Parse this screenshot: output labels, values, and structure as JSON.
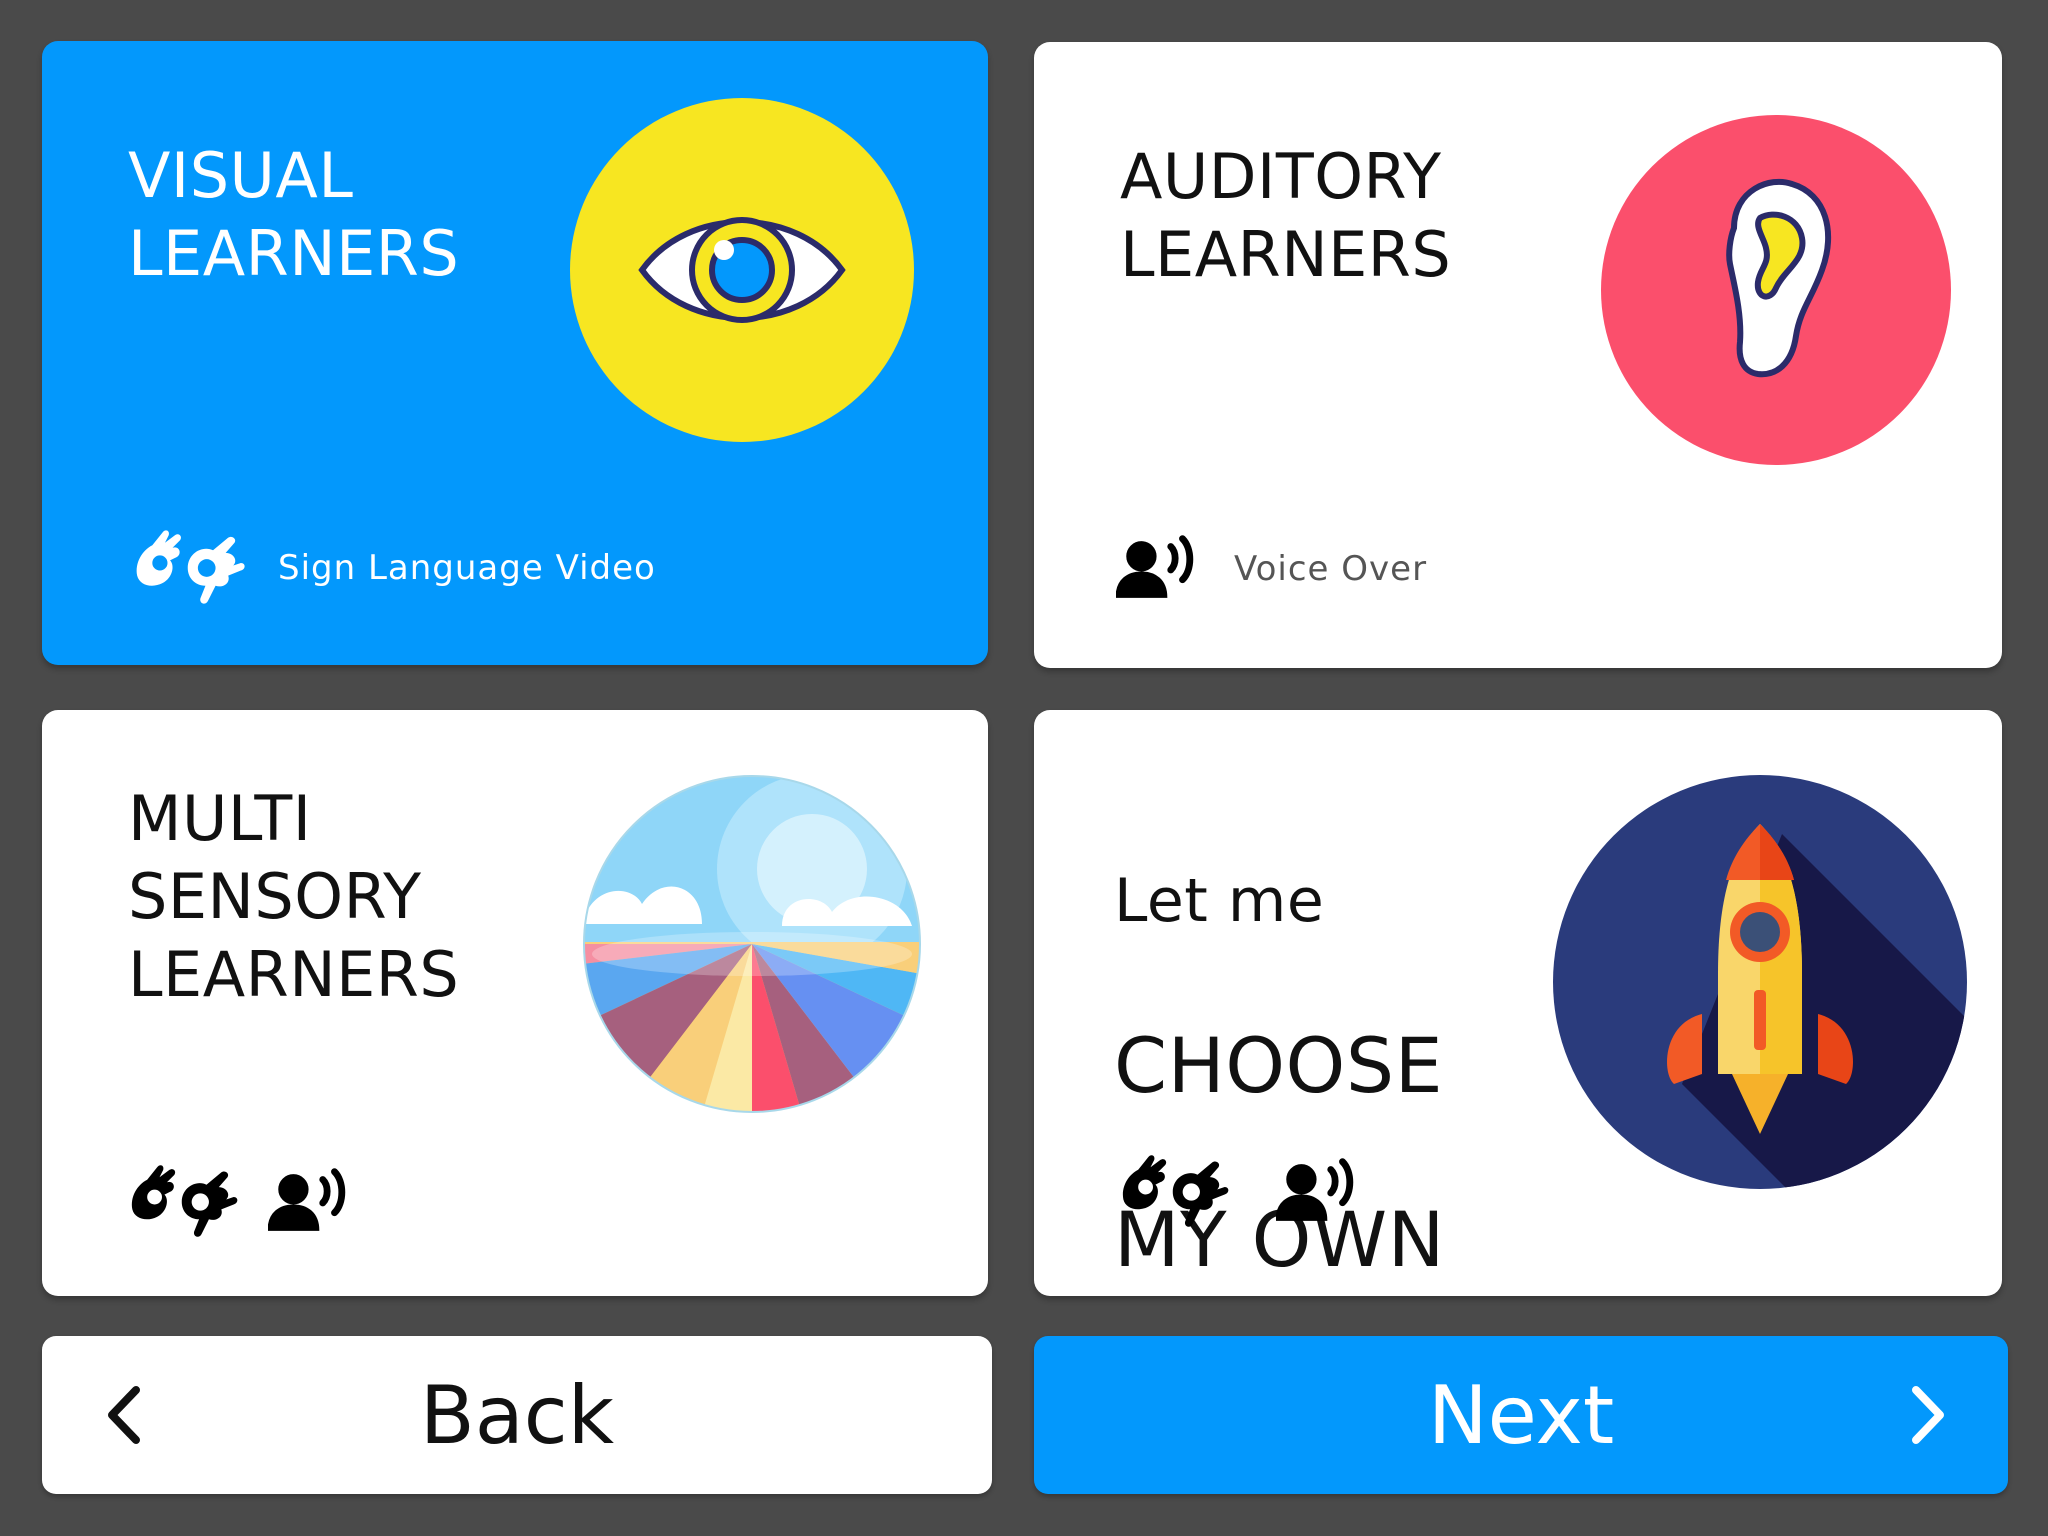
{
  "cards": {
    "visual": {
      "title": "VISUAL\nLEARNERS",
      "feature": "Sign Language Video",
      "selected": true
    },
    "auditory": {
      "title": "AUDITORY\nLEARNERS",
      "feature": "Voice Over"
    },
    "multi": {
      "title": "MULTI\nSENSORY\nLEARNERS"
    },
    "choose": {
      "title_line1": "Let me",
      "title_line2": "CHOOSE",
      "title_line3": "MY OWN"
    }
  },
  "nav": {
    "back_label": "Back",
    "next_label": "Next"
  },
  "colors": {
    "background": "#4a4a4a",
    "accent": "#0398fc",
    "card": "#ffffff",
    "eye_circle": "#f7e621",
    "ear_circle": "#fb4f6c",
    "rocket_circle": "#2a3b7c"
  },
  "icons": {
    "visual": "eye-icon",
    "auditory": "ear-icon",
    "multi": "landscape-icon",
    "choose": "rocket-icon",
    "sign": "sign-language-icon",
    "voice": "voice-over-icon",
    "back": "chevron-left-icon",
    "next": "chevron-right-icon"
  }
}
